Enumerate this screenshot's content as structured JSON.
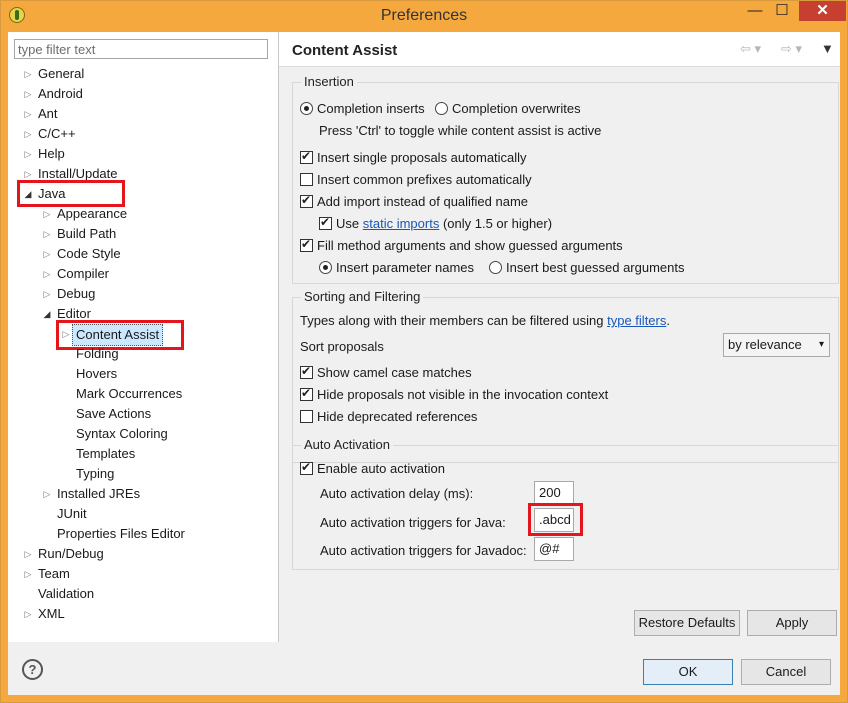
{
  "window": {
    "title": "Preferences",
    "minimize": "—",
    "maximize": "☐",
    "close": "✕"
  },
  "filter": {
    "placeholder": "type filter text"
  },
  "tree": {
    "general": "General",
    "android": "Android",
    "ant": "Ant",
    "cpp": "C/C++",
    "help": "Help",
    "install_update": "Install/Update",
    "java": "Java",
    "appearance": "Appearance",
    "build_path": "Build Path",
    "code_style": "Code Style",
    "compiler": "Compiler",
    "debug": "Debug",
    "editor": "Editor",
    "content_assist": "Content Assist",
    "folding": "Folding",
    "hovers": "Hovers",
    "mark_occurrences": "Mark Occurrences",
    "save_actions": "Save Actions",
    "syntax_coloring": "Syntax Coloring",
    "templates": "Templates",
    "typing": "Typing",
    "installed_jres": "Installed JREs",
    "junit": "JUnit",
    "properties_files_editor": "Properties Files Editor",
    "run_debug": "Run/Debug",
    "team": "Team",
    "validation": "Validation",
    "xml": "XML"
  },
  "page": {
    "title": "Content Assist",
    "nav_back": "⇦ ▾",
    "nav_forward": "⇨ ▾",
    "nav_menu": "▼"
  },
  "insertion": {
    "title": "Insertion",
    "completion_inserts": "Completion inserts",
    "completion_overwrites": "Completion overwrites",
    "toggle_hint": "Press 'Ctrl' to toggle while content assist is active",
    "insert_single": "Insert single proposals automatically",
    "insert_common": "Insert common prefixes automatically",
    "add_import": "Add import instead of qualified name",
    "use_label": "Use",
    "static_imports": "static imports",
    "use_suffix": "(only 1.5 or higher)",
    "fill_method": "Fill method arguments and show guessed arguments",
    "insert_param_names": "Insert parameter names",
    "insert_best_guessed": "Insert best guessed arguments"
  },
  "sorting": {
    "title": "Sorting and Filtering",
    "types_prefix": "Types along with their members can be filtered using",
    "type_filters": "type filters",
    "types_suffix": ".",
    "sort_proposals": "Sort proposals",
    "sort_value": "by relevance",
    "camel_case": "Show camel case matches",
    "hide_not_visible": "Hide proposals not visible in the invocation context",
    "hide_deprecated": "Hide deprecated references"
  },
  "auto": {
    "title": "Auto Activation",
    "enable": "Enable auto activation",
    "delay_label": "Auto activation delay (ms):",
    "delay_value": "200",
    "java_label": "Auto activation triggers for Java:",
    "java_value": ".abcd",
    "javadoc_label": "Auto activation triggers for Javadoc:",
    "javadoc_value": "@#"
  },
  "buttons": {
    "restore_defaults": "Restore Defaults",
    "apply": "Apply",
    "ok": "OK",
    "cancel": "Cancel",
    "help": "?"
  },
  "colors": {
    "accent_frame": "#f4a83e",
    "highlight_box": "#e5151d",
    "link": "#1857b8",
    "selection": "#cce8ff"
  }
}
